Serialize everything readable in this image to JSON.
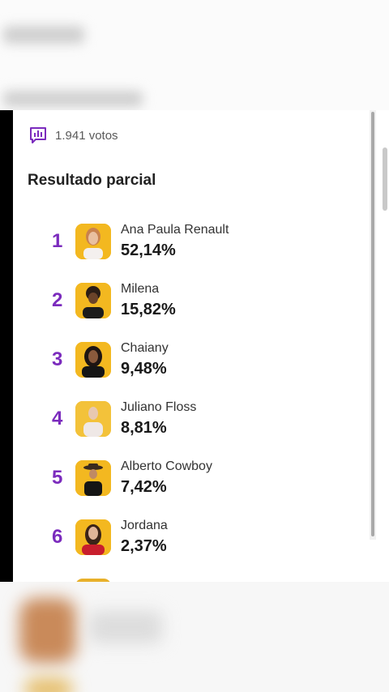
{
  "votes": {
    "count_text": "1.941 votos",
    "icon": "bar-chart-icon"
  },
  "title": "Resultado parcial",
  "accent_color": "#7b2bbd",
  "candidates": [
    {
      "rank": "1",
      "name": "Ana Paula Renault",
      "percent": "52,14%",
      "avatar": "person-avatar"
    },
    {
      "rank": "2",
      "name": "Milena",
      "percent": "15,82%",
      "avatar": "person-avatar"
    },
    {
      "rank": "3",
      "name": "Chaiany",
      "percent": "9,48%",
      "avatar": "person-avatar"
    },
    {
      "rank": "4",
      "name": "Juliano Floss",
      "percent": "8,81%",
      "avatar": "person-avatar"
    },
    {
      "rank": "5",
      "name": "Alberto Cowboy",
      "percent": "7,42%",
      "avatar": "person-avatar"
    },
    {
      "rank": "6",
      "name": "Jordana",
      "percent": "2,37%",
      "avatar": "person-avatar"
    }
  ]
}
